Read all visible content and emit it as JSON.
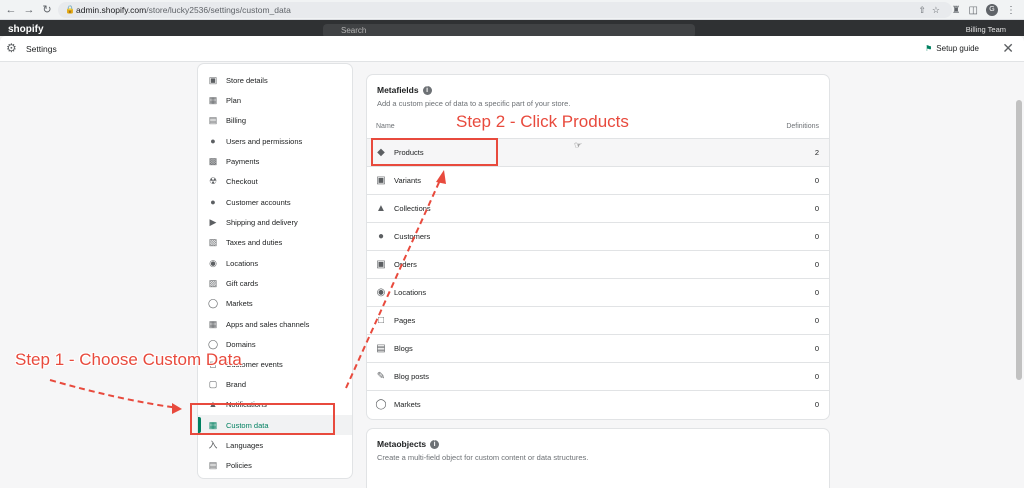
{
  "browser": {
    "url_host": "admin.shopify.com",
    "url_path": "/store/lucky2536/settings/custom_data",
    "profile_initial": "G"
  },
  "shopify_bar": {
    "logo": "shopify",
    "search_placeholder": "Search",
    "user_name": "Billing Team"
  },
  "settings": {
    "title": "Settings",
    "setup_guide_label": "Setup guide"
  },
  "sidebar": {
    "items": [
      {
        "label": "Store details",
        "icon": "store-icon"
      },
      {
        "label": "Plan",
        "icon": "plan-icon"
      },
      {
        "label": "Billing",
        "icon": "billing-icon"
      },
      {
        "label": "Users and permissions",
        "icon": "user-icon"
      },
      {
        "label": "Payments",
        "icon": "payments-icon"
      },
      {
        "label": "Checkout",
        "icon": "cart-icon"
      },
      {
        "label": "Customer accounts",
        "icon": "customer-icon"
      },
      {
        "label": "Shipping and delivery",
        "icon": "truck-icon"
      },
      {
        "label": "Taxes and duties",
        "icon": "tax-icon"
      },
      {
        "label": "Locations",
        "icon": "location-icon"
      },
      {
        "label": "Gift cards",
        "icon": "gift-icon"
      },
      {
        "label": "Markets",
        "icon": "globe-icon"
      },
      {
        "label": "Apps and sales channels",
        "icon": "apps-icon"
      },
      {
        "label": "Domains",
        "icon": "globe-icon"
      },
      {
        "label": "Customer events",
        "icon": "events-icon"
      },
      {
        "label": "Brand",
        "icon": "brand-icon"
      },
      {
        "label": "Notifications",
        "icon": "bell-icon"
      },
      {
        "label": "Custom data",
        "icon": "custom-data-icon"
      },
      {
        "label": "Languages",
        "icon": "languages-icon"
      },
      {
        "label": "Policies",
        "icon": "policies-icon"
      }
    ]
  },
  "metafields": {
    "title": "Metafields",
    "subtitle": "Add a custom piece of data to a specific part of your store.",
    "col_name": "Name",
    "col_definitions": "Definitions",
    "rows": [
      {
        "label": "Products",
        "count": "2"
      },
      {
        "label": "Variants",
        "count": "0"
      },
      {
        "label": "Collections",
        "count": "0"
      },
      {
        "label": "Customers",
        "count": "0"
      },
      {
        "label": "Orders",
        "count": "0"
      },
      {
        "label": "Locations",
        "count": "0"
      },
      {
        "label": "Pages",
        "count": "0"
      },
      {
        "label": "Blogs",
        "count": "0"
      },
      {
        "label": "Blog posts",
        "count": "0"
      },
      {
        "label": "Markets",
        "count": "0"
      }
    ]
  },
  "metaobjects": {
    "title": "Metaobjects",
    "subtitle": "Create a multi-field object for custom content or data structures."
  },
  "annotations": {
    "step1": "Step 1 - Choose Custom Data",
    "step2": "Step 2 - Click Products",
    "color": "#e84a3d"
  }
}
